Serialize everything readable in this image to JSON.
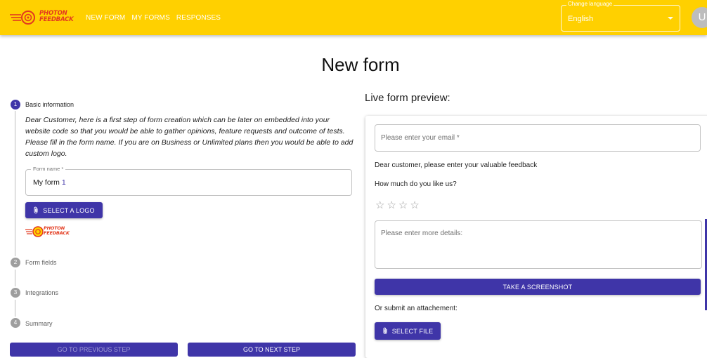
{
  "app": {
    "logo_line1": "PHOTON",
    "logo_line2": "FEEDBACK",
    "brand_color": "#ffd000",
    "accent_color": "#3f35a8",
    "logo_color": "#e33a1f"
  },
  "nav": {
    "new_form": "NEW FORM",
    "my_forms": "MY FORMS",
    "responses": "RESPONSES"
  },
  "language": {
    "label": "Change language",
    "value": "English"
  },
  "user": {
    "avatar_initial": "U"
  },
  "page": {
    "title": "New form"
  },
  "stepper": {
    "steps": [
      {
        "number": "1",
        "label": "Basic information"
      },
      {
        "number": "2",
        "label": "Form fields"
      },
      {
        "number": "3",
        "label": "Integrations"
      },
      {
        "number": "4",
        "label": "Summary"
      }
    ],
    "intro": "Dear Customer, here is a first step of form creation which can be later on embedded into your website code so that you would be able to gather opinions, feature requests and outcome of tests. Please fill in the form name. If you are on Business or Unlimited plans then you would be able to add custom logo.",
    "form_name_label": "Form name *",
    "form_name_value": "My form",
    "form_name_value_suffix": "1",
    "select_logo": "SELECT A LOGO",
    "prev_button": "GO TO PREVIOUS STEP",
    "next_button": "GO TO NEXT STEP"
  },
  "preview": {
    "title": "Live form preview:",
    "email_placeholder": "Please enter your email *",
    "greeting": "Dear customer, please enter your valuable feedback",
    "question": "How much do you like us?",
    "rating": 0,
    "rating_max": 5,
    "details_placeholder": "Please enter more details:",
    "screenshot_button": "TAKE A SCREENSHOT",
    "attachment_label": "Or submit an attachement:",
    "select_file": "SELECT FILE"
  }
}
